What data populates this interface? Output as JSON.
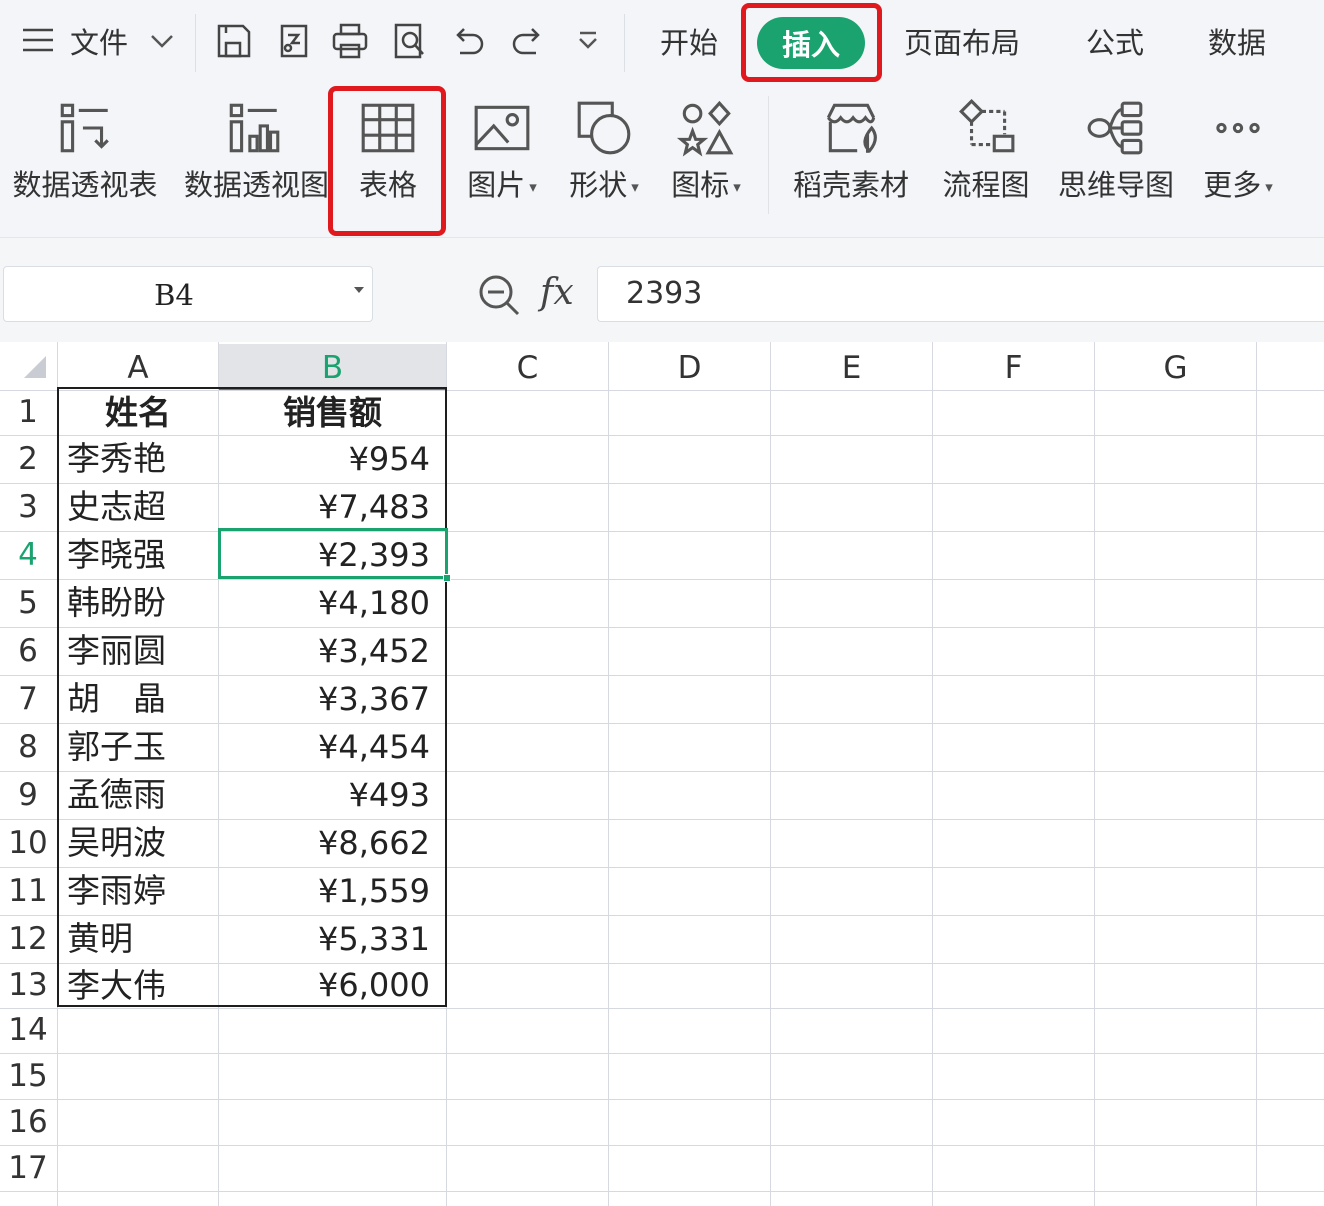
{
  "menu": {
    "file_label": "文件",
    "tabs": [
      "开始",
      "插入",
      "页面布局",
      "公式",
      "数据"
    ],
    "active_tab": "插入"
  },
  "ribbon": {
    "items": [
      {
        "label": "数据透视表",
        "icon": "pivot-table-icon"
      },
      {
        "label": "数据透视图",
        "icon": "pivot-chart-icon"
      },
      {
        "label": "表格",
        "icon": "table-icon"
      },
      {
        "label": "图片",
        "icon": "picture-icon",
        "dropdown": true
      },
      {
        "label": "形状",
        "icon": "shapes-icon",
        "dropdown": true
      },
      {
        "label": "图标",
        "icon": "icons-icon",
        "dropdown": true
      },
      {
        "label": "稻壳素材",
        "icon": "docer-material-icon"
      },
      {
        "label": "流程图",
        "icon": "flowchart-icon"
      },
      {
        "label": "思维导图",
        "icon": "mindmap-icon"
      },
      {
        "label": "更多",
        "icon": "more-icon",
        "dropdown": true
      }
    ]
  },
  "formula_bar": {
    "name_box": "B4",
    "fx": "fx",
    "value": "2393"
  },
  "sheet": {
    "columns": [
      "A",
      "B",
      "C",
      "D",
      "E",
      "F",
      "G"
    ],
    "selected_column": "B",
    "selected_row": 4,
    "row_numbers": [
      "1",
      "2",
      "3",
      "4",
      "5",
      "6",
      "7",
      "8",
      "9",
      "10",
      "11",
      "12",
      "13",
      "14",
      "15",
      "16",
      "17"
    ],
    "headers": [
      "姓名",
      "销售额"
    ],
    "rows": [
      [
        "李秀艳",
        "¥954"
      ],
      [
        "史志超",
        "¥7,483"
      ],
      [
        "李晓强",
        "¥2,393"
      ],
      [
        "韩盼盼",
        "¥4,180"
      ],
      [
        "李丽圆",
        "¥3,452"
      ],
      [
        "胡　晶",
        "¥3,367"
      ],
      [
        "郭子玉",
        "¥4,454"
      ],
      [
        "孟德雨",
        "¥493"
      ],
      [
        "吴明波",
        "¥8,662"
      ],
      [
        "李雨婷",
        "¥1,559"
      ],
      [
        "黄明",
        "¥5,331"
      ],
      [
        "李大伟",
        "¥6,000"
      ]
    ]
  },
  "colors": {
    "accent_green": "#1aa36f",
    "highlight_red": "#e0191e"
  }
}
